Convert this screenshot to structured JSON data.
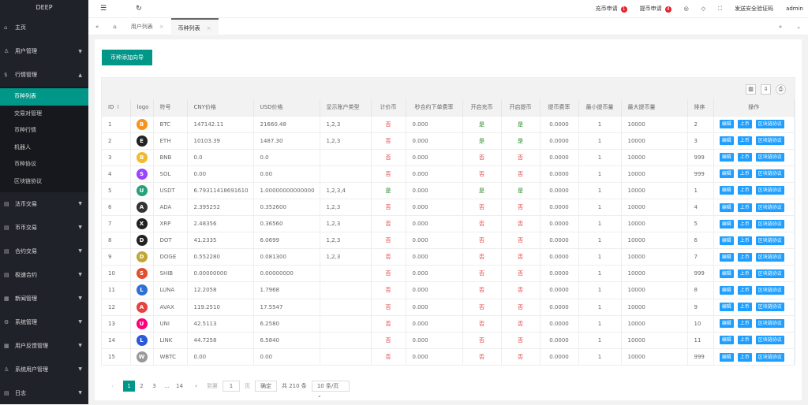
{
  "app": {
    "title": "DEEP"
  },
  "sidebar": {
    "items": [
      {
        "label": "主页",
        "icon": "home-icon"
      },
      {
        "label": "用户管理",
        "icon": "user-icon",
        "arrow": "down"
      },
      {
        "label": "行情管理",
        "icon": "dollar-icon",
        "arrow": "up",
        "children": [
          "币种列表",
          "交易对管理",
          "币种行情",
          "机器人",
          "币种协议",
          "区块链协议"
        ],
        "active_child": 0
      },
      {
        "label": "法币交易",
        "icon": "doc-icon",
        "arrow": "down"
      },
      {
        "label": "币币交易",
        "icon": "doc-icon",
        "arrow": "down"
      },
      {
        "label": "合约交易",
        "icon": "doc-icon",
        "arrow": "down"
      },
      {
        "label": "极速合约",
        "icon": "doc-icon",
        "arrow": "down"
      },
      {
        "label": "新闻管理",
        "icon": "news-icon",
        "arrow": "down"
      },
      {
        "label": "系统管理",
        "icon": "gear-icon",
        "arrow": "down"
      },
      {
        "label": "用户反馈管理",
        "icon": "news-icon",
        "arrow": "down"
      },
      {
        "label": "系统用户管理",
        "icon": "user-icon",
        "arrow": "down"
      },
      {
        "label": "日志",
        "icon": "doc-icon",
        "arrow": "down"
      }
    ]
  },
  "header": {
    "recharge_label": "充币申请",
    "recharge_count": "1",
    "withdraw_label": "提币申请",
    "withdraw_count": "4",
    "send_code_label": "发送安全验证码",
    "user": "admin"
  },
  "tabs": [
    {
      "label": "用户列表"
    },
    {
      "label": "币种列表",
      "active": true
    }
  ],
  "main": {
    "add_button": "币种添加向导",
    "columns": [
      "ID",
      "logo",
      "符号",
      "CNY价格",
      "USD价格",
      "显示账户类型",
      "计价币",
      "秒合约下单费率",
      "开启充币",
      "开启提币",
      "提币费率",
      "最小提币量",
      "最大提币量",
      "排序",
      "操作"
    ],
    "actions": [
      "编辑",
      "上币",
      "区块链协议"
    ],
    "rows": [
      [
        "1",
        "BTC",
        "147142.11",
        "21660.48",
        "1,2,3",
        "否",
        "0.000",
        "是",
        "是",
        "0.0000",
        "1",
        "10000",
        "2"
      ],
      [
        "2",
        "ETH",
        "10103.39",
        "1487.30",
        "1,2,3",
        "否",
        "0.000",
        "是",
        "是",
        "0.0000",
        "1",
        "10000",
        "3"
      ],
      [
        "3",
        "BNB",
        "0.0",
        "0.0",
        "",
        "否",
        "0.000",
        "否",
        "否",
        "0.0000",
        "1",
        "10000",
        "999"
      ],
      [
        "4",
        "SOL",
        "0.00",
        "0.00",
        "",
        "否",
        "0.000",
        "否",
        "否",
        "0.0000",
        "1",
        "10000",
        "999"
      ],
      [
        "5",
        "USDT",
        "6.79311418691610",
        "1.00000000000000",
        "1,2,3,4",
        "是",
        "0.000",
        "是",
        "是",
        "0.0000",
        "1",
        "10000",
        "1"
      ],
      [
        "6",
        "ADA",
        "2.395252",
        "0.352600",
        "1,2,3",
        "否",
        "0.000",
        "否",
        "否",
        "0.0000",
        "1",
        "10000",
        "4"
      ],
      [
        "7",
        "XRP",
        "2.48356",
        "0.36560",
        "1,2,3",
        "否",
        "0.000",
        "否",
        "否",
        "0.0000",
        "1",
        "10000",
        "5"
      ],
      [
        "8",
        "DOT",
        "41.2335",
        "6.0699",
        "1,2,3",
        "否",
        "0.000",
        "否",
        "否",
        "0.0000",
        "1",
        "10000",
        "6"
      ],
      [
        "9",
        "DOGE",
        "0.552280",
        "0.081300",
        "1,2,3",
        "否",
        "0.000",
        "否",
        "否",
        "0.0000",
        "1",
        "10000",
        "7"
      ],
      [
        "10",
        "SHIB",
        "0.00000000",
        "0.00000000",
        "",
        "否",
        "0.000",
        "否",
        "否",
        "0.0000",
        "1",
        "10000",
        "999"
      ],
      [
        "11",
        "LUNA",
        "12.2058",
        "1.7968",
        "",
        "否",
        "0.000",
        "否",
        "否",
        "0.0000",
        "1",
        "10000",
        "8"
      ],
      [
        "12",
        "AVAX",
        "119.2510",
        "17.5547",
        "",
        "否",
        "0.000",
        "否",
        "否",
        "0.0000",
        "1",
        "10000",
        "9"
      ],
      [
        "13",
        "UNI",
        "42.5113",
        "6.2580",
        "",
        "否",
        "0.000",
        "否",
        "否",
        "0.0000",
        "1",
        "10000",
        "10"
      ],
      [
        "14",
        "LINK",
        "44.7258",
        "6.5840",
        "",
        "否",
        "0.000",
        "否",
        "否",
        "0.0000",
        "1",
        "10000",
        "11"
      ],
      [
        "15",
        "WBTC",
        "0.00",
        "0.00",
        "",
        "否",
        "0.000",
        "否",
        "否",
        "0.0000",
        "1",
        "10000",
        "999"
      ]
    ],
    "logo_colors": {
      "BTC": "#f7931a",
      "ETH": "#222222",
      "BNB": "#f3ba2f",
      "SOL": "#9945ff",
      "USDT": "#26a17b",
      "ADA": "#333333",
      "XRP": "#222222",
      "DOT": "#222222",
      "DOGE": "#c2a633",
      "SHIB": "#e0502c",
      "LUNA": "#2f6fd6",
      "AVAX": "#e84142",
      "UNI": "#ff007a",
      "LINK": "#2a5ada",
      "WBTC": "#999999"
    }
  },
  "pagination": {
    "pages": [
      "1",
      "2",
      "3",
      "...",
      "14"
    ],
    "current": "1",
    "goto_label": "到第",
    "goto_value": "1",
    "page_unit": "页",
    "confirm": "确定",
    "total": "共 210 条",
    "page_size": "10 条/页"
  },
  "colors": {
    "accent": "#009688",
    "sidebar": "#20222a",
    "action": "#1e9fff",
    "no": "#e23c3c",
    "yes": "#2a8a2a"
  }
}
